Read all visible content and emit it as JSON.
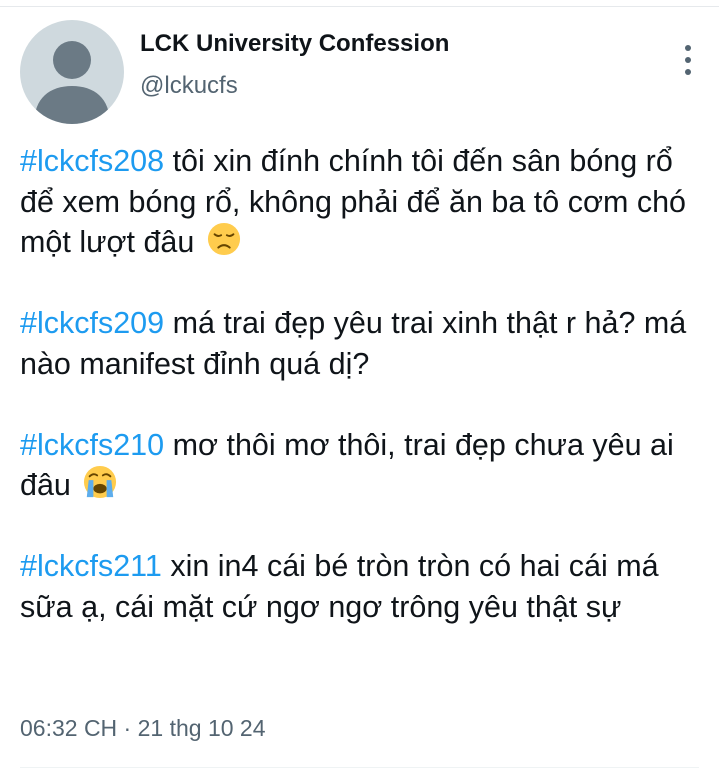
{
  "tweet": {
    "author": {
      "display_name": "LCK University Confession",
      "handle": "@lckucfs",
      "avatar_icon": "default-avatar-icon"
    },
    "menu_icon": "more-vertical-icon",
    "paragraphs": [
      {
        "hashtag": "#lckcfs208",
        "text": " tôi xin đính chính tôi đến sân bóng rổ để xem bóng rổ, không phải để ăn ba tô cơm chó một lượt đâu",
        "emoji": "disappointed-face-emoji"
      },
      {
        "hashtag": "#lckcfs209",
        "text": " má trai đẹp yêu trai xinh thật r hả? má nào manifest đỉnh quá dị?"
      },
      {
        "hashtag": "#lckcfs210",
        "text": " mơ thôi mơ thôi, trai đẹp chưa yêu ai đâu",
        "emoji": "loudly-crying-face-emoji"
      },
      {
        "hashtag": "#lckcfs211",
        "text": " xin in4 cái bé tròn tròn có hai cái má sữa ạ, cái mặt cứ ngơ ngơ trông yêu thật sự"
      }
    ],
    "timestamp": "06:32 CH · 21 thg 10 24"
  },
  "colors": {
    "hashtag": "#1d9bf0",
    "text": "#0f1419",
    "secondary": "#536471",
    "avatar_bg": "#cfd9de",
    "avatar_fg": "#6b7a85"
  }
}
